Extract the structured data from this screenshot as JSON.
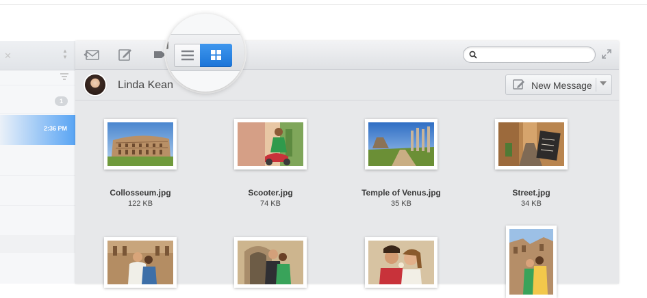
{
  "message_list": {
    "unread_badge": "1",
    "selected_time": "2:36 PM"
  },
  "toolbar": {
    "search_placeholder": "",
    "icons": [
      "reply-all-icon",
      "compose-icon",
      "label-icon",
      "list-view-icon",
      "grid-view-icon",
      "search-icon",
      "expand-icon"
    ],
    "active_view": "grid"
  },
  "conversation": {
    "contact_name": "Linda Kean",
    "new_message_label": "New Message"
  },
  "files": [
    {
      "name": "Collosseum.jpg",
      "size": "122 KB"
    },
    {
      "name": "Scooter.jpg",
      "size": "74 KB"
    },
    {
      "name": "Temple of Venus.jpg",
      "size": "35 KB"
    },
    {
      "name": "Street.jpg",
      "size": "34 KB"
    }
  ],
  "colors": {
    "accent": "#2a84e6",
    "selection": "#58a4f4",
    "window_bg": "#e7e8ea"
  }
}
